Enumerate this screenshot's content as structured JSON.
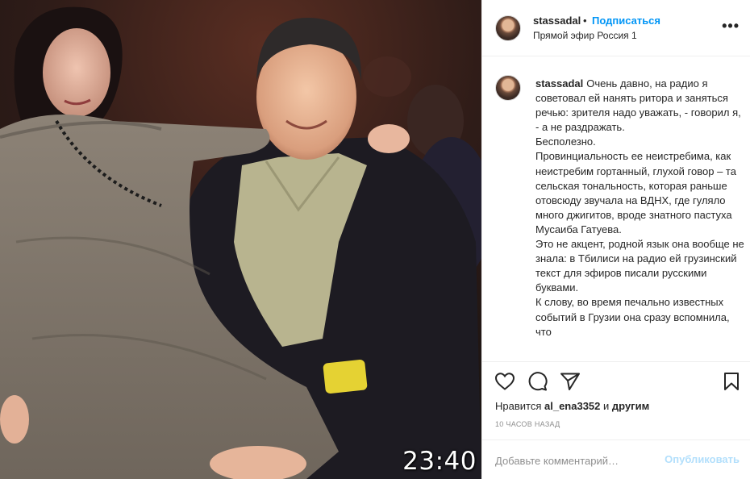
{
  "photo": {
    "timestamp": "23:40"
  },
  "post": {
    "username": "stassadal",
    "separator": "•",
    "follow_label": "Подписаться",
    "location": "Прямой эфир Россия 1",
    "more_icon": "more-horizontal-icon"
  },
  "caption": {
    "username": "stassadal",
    "lines": [
      "Очень давно, на радио я советовал ей нанять ритора и заняться речью: зрителя надо уважать, - говорил я, - а не раздражать.",
      "Бесполезно.",
      "Провинциальность ее неистребима, как неистребим гортанный, глухой говор – та сельская тональность, которая раньше отовсюду звучала на ВДНХ, где гуляло много джигитов, вроде знатного пастуха Мусаиба Гатуева.",
      "Это не акцент, родной язык она вообще не знала: в Тбилиси на радио ей грузинский текст для эфиров писали русскими буквами.",
      "К слову, во время печально известных событий в Грузии она сразу вспомнила, что"
    ]
  },
  "actions": {
    "like_icon": "heart-icon",
    "comment_icon": "comment-icon",
    "share_icon": "send-icon",
    "save_icon": "bookmark-icon"
  },
  "likes": {
    "prefix": "Нравится",
    "user": "al_ena3352",
    "middle": "и",
    "others": "другим"
  },
  "time_ago": "10 ЧАСОВ НАЗАД",
  "comment": {
    "placeholder": "Добавьте комментарий…",
    "publish_label": "Опубликовать"
  },
  "colors": {
    "accent": "#0095f6",
    "publish_disabled": "#b2dffc",
    "muted": "#8e8e8e",
    "border": "#efefef"
  }
}
